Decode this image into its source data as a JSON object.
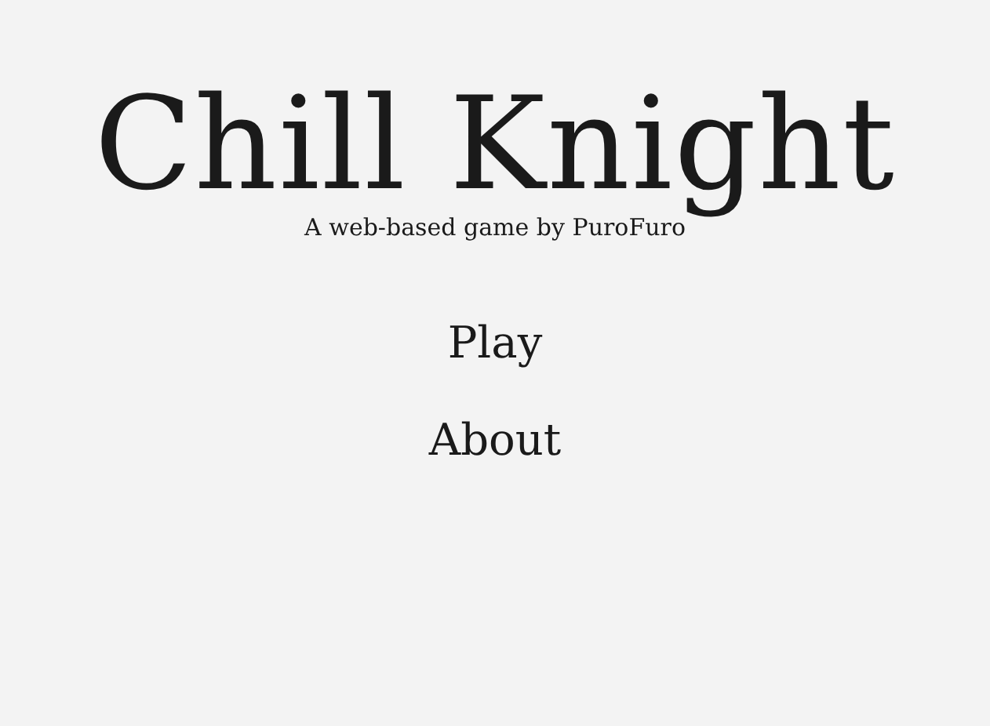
{
  "title": "Chill Knight",
  "subtitle": "A web-based game by PuroFuro",
  "menu": [
    {
      "label": "Play"
    },
    {
      "label": "About"
    }
  ]
}
